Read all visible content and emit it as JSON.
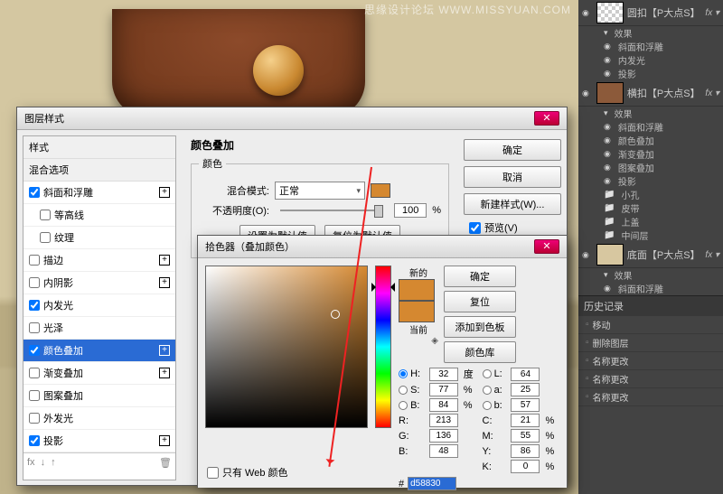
{
  "watermark": "思缘设计论坛  WWW.MISSYUAN.COM",
  "layerStyleDialog": {
    "title": "图层样式",
    "leftHeader1": "样式",
    "leftHeader2": "混合选项",
    "items": [
      {
        "label": "斜面和浮雕",
        "checked": true,
        "plus": true
      },
      {
        "label": "等高线",
        "checked": false,
        "indent": true
      },
      {
        "label": "纹理",
        "checked": false,
        "indent": true
      },
      {
        "label": "描边",
        "checked": false,
        "plus": true
      },
      {
        "label": "内阴影",
        "checked": false,
        "plus": true
      },
      {
        "label": "内发光",
        "checked": true
      },
      {
        "label": "光泽",
        "checked": false
      },
      {
        "label": "颜色叠加",
        "checked": true,
        "plus": true,
        "selected": true
      },
      {
        "label": "渐变叠加",
        "checked": false,
        "plus": true
      },
      {
        "label": "图案叠加",
        "checked": false
      },
      {
        "label": "外发光",
        "checked": false
      },
      {
        "label": "投影",
        "checked": true,
        "plus": true
      }
    ],
    "footIcons": [
      "fx",
      "↓",
      "↑",
      "🗑"
    ],
    "sectionTitle": "颜色叠加",
    "groupTitle": "颜色",
    "blendLabel": "混合模式:",
    "blendValue": "正常",
    "opacityLabel": "不透明度(O):",
    "opacityValue": "100",
    "opacityUnit": "%",
    "btnMakeDefault": "设置为默认值",
    "btnResetDefault": "复位为默认值",
    "btnOK": "确定",
    "btnCancel": "取消",
    "btnNewStyle": "新建样式(W)...",
    "chkPreview": "预览(V)"
  },
  "colorPicker": {
    "title": "拾色器（叠加颜色）",
    "labelNew": "新的",
    "labelCurrent": "当前",
    "btnOK": "确定",
    "btnReset": "复位",
    "btnAddSwatch": "添加到色板",
    "btnLibraries": "颜色库",
    "H": {
      "k": "H:",
      "v": "32",
      "u": "度"
    },
    "S": {
      "k": "S:",
      "v": "77",
      "u": "%"
    },
    "Bv": {
      "k": "B:",
      "v": "84",
      "u": "%"
    },
    "L": {
      "k": "L:",
      "v": "64"
    },
    "a": {
      "k": "a:",
      "v": "25"
    },
    "b2": {
      "k": "b:",
      "v": "57"
    },
    "R": {
      "k": "R:",
      "v": "213"
    },
    "G": {
      "k": "G:",
      "v": "136"
    },
    "Bc": {
      "k": "B:",
      "v": "48"
    },
    "C": {
      "k": "C:",
      "v": "21",
      "u": "%"
    },
    "M": {
      "k": "M:",
      "v": "55",
      "u": "%"
    },
    "Y": {
      "k": "Y:",
      "v": "86",
      "u": "%"
    },
    "K": {
      "k": "K:",
      "v": "0",
      "u": "%"
    },
    "hexLabel": "#",
    "hexValue": "d58830",
    "webOnly": "只有 Web 颜色"
  },
  "layersPanel": {
    "layers": [
      {
        "name": "圆扣【P大点S】",
        "fx": true,
        "effects": [
          "效果",
          "斜面和浮雕",
          "内发光",
          "投影"
        ]
      },
      {
        "name": "横扣【P大点S】",
        "fx": true,
        "effects": [
          "效果",
          "斜面和浮雕",
          "颜色叠加",
          "渐变叠加",
          "图案叠加",
          "投影"
        ]
      }
    ],
    "folders": [
      "小孔",
      "皮带",
      "上盖",
      "中间层"
    ],
    "baseLayer": {
      "name": "底面【P大点S】",
      "fx": true,
      "effects": [
        "效果",
        "斜面和浮雕"
      ]
    }
  },
  "historyPanel": {
    "title": "历史记录",
    "items": [
      "移动",
      "删除图层",
      "名称更改",
      "名称更改",
      "名称更改"
    ]
  }
}
